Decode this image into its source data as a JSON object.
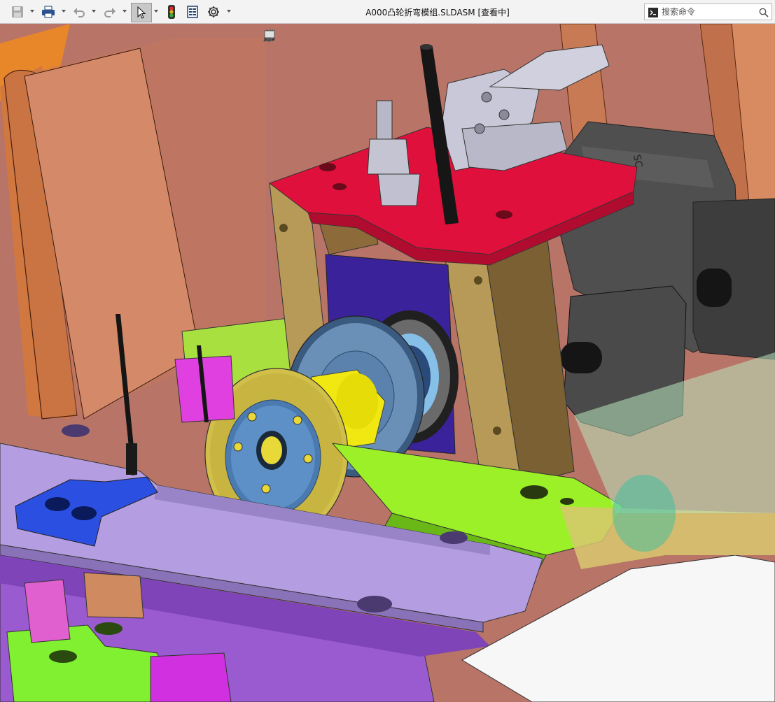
{
  "window": {
    "title": "A000凸轮折弯模组.SLDASM [查看中]"
  },
  "toolbar": {
    "items": [
      {
        "name": "save",
        "icon": "save-icon"
      },
      {
        "name": "print",
        "icon": "print-icon"
      },
      {
        "name": "undo",
        "icon": "undo-icon"
      },
      {
        "name": "redo",
        "icon": "redo-icon"
      },
      {
        "name": "select",
        "icon": "select-cursor-icon",
        "active": true
      },
      {
        "name": "rebuild",
        "icon": "traffic-light-icon"
      },
      {
        "name": "file-properties",
        "icon": "file-properties-icon"
      },
      {
        "name": "options",
        "icon": "gear-icon"
      }
    ]
  },
  "search": {
    "placeholder": "搜索命令",
    "value": ""
  },
  "heads_up_toolbar": {
    "items": [
      "zoom-to-fit-icon",
      "zoom-to-area-icon",
      "previous-view-icon",
      "section-view-icon",
      "view-orientation-icon",
      "display-style-icon",
      "hide-show-icon",
      "edit-appearance-icon",
      "apply-scene-icon",
      "view-settings-icon"
    ]
  },
  "viewport": {
    "content": "3d-assembly-model",
    "colors": {
      "background_wall": "#b87466",
      "red_plate": "#e0103c",
      "frame": "#a88e52",
      "motor": "#4a4a4a",
      "gear": "#d2bf4a",
      "hub": "#6a8fb8",
      "yellow_cam": "#f0ea10",
      "purple_plate": "#b39ae0",
      "green_plate": "#9cf028",
      "blue_block": "#2b4fe0",
      "magenta": "#e040e0"
    }
  }
}
